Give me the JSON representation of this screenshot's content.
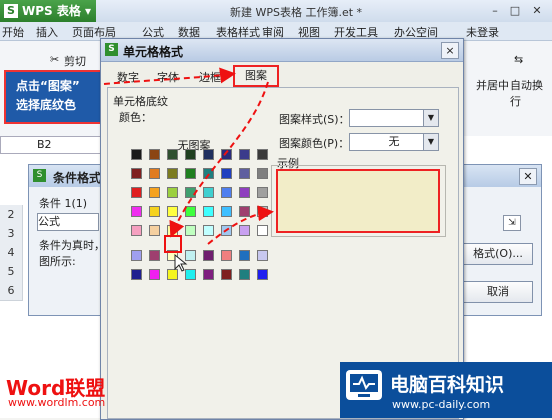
{
  "app": {
    "name": "WPS 表格",
    "doc_title": "新建 WPS表格 工作簿.et *"
  },
  "menu": {
    "items": [
      "开始",
      "插入",
      "页面布局",
      "公式",
      "数据",
      "表格样式",
      "审阅",
      "视图",
      "开发工具",
      "办公空间"
    ],
    "login": "未登录"
  },
  "ribbon": {
    "cut": "剪切",
    "merge": "并居中",
    "autowrap": "自动换行"
  },
  "namebox": "B2",
  "rows": [
    "2",
    "3",
    "4",
    "5",
    "6"
  ],
  "callout": {
    "line1": "点击“图案”",
    "line2": "选择底纹色"
  },
  "cond_dialog": {
    "title": "条件格式",
    "condition_label": "条件 1(1)",
    "formula_label": "公式",
    "desc": "条件为真时，",
    "desc2": "图所示:",
    "format_btn": "格式(O)...",
    "cancel_btn": "取消"
  },
  "dialog": {
    "title": "单元格格式",
    "close": "×",
    "tabs": [
      "数字",
      "字体",
      "边框",
      "图案"
    ],
    "section": "单元格底纹",
    "color_label": "颜色：",
    "no_color": "无图案",
    "pattern_style_label": "图案样式(S)：",
    "pattern_color_label": "图案颜色(P)：",
    "pattern_color_value": "无",
    "sample_label": "示例",
    "palette": [
      [
        "#1a1a1a",
        "#8b4513",
        "#2f4f2f",
        "#1f3f1f",
        "#1f2f5f",
        "#2b2b7b",
        "#3b3b8b",
        "#3a3a3a"
      ],
      [
        "#7f1f1f",
        "#e07b1f",
        "#7b7b1f",
        "#1f7f1f",
        "#1f7f7f",
        "#1f3fbf",
        "#5f5f9f",
        "#7f7f7f"
      ],
      [
        "#df1f1f",
        "#f5a21f",
        "#9bcf3f",
        "#3f9f6f",
        "#3fcfcf",
        "#4f7fef",
        "#8f3fbf",
        "#9f9f9f"
      ],
      [
        "#ef2fef",
        "#f5d21f",
        "#ffff3f",
        "#3fff3f",
        "#3fffff",
        "#3fbfff",
        "#9f3f6f",
        "#c0c0c0"
      ],
      [
        "#f5a0c0",
        "#f5d0a0",
        "#ffffa0",
        "#c0ffc0",
        "#c0ffff",
        "#a0c8f0",
        "#c8a0f0",
        "#ffffff"
      ],
      [
        "#9f9fef",
        "#9f3f6f",
        "#ffffc0",
        "#c0f0f0",
        "#6f1f6f",
        "#ef7f7f",
        "#1f6fbf",
        "#c8c8ef"
      ],
      [
        "#1f1f8f",
        "#ef1fef",
        "#f5f51f",
        "#1fefef",
        "#7f1f7f",
        "#7f1f1f",
        "#1f7f7f",
        "#1f1fef"
      ]
    ]
  },
  "logos": {
    "word": "Word联盟",
    "word_url": "www.wordlm.com",
    "site_name": "电脑百科知识",
    "site_url": "www.pc-daily.com"
  },
  "colors": {
    "accent_red": "#e22222",
    "dialog_blue": "#0b4e9b"
  }
}
